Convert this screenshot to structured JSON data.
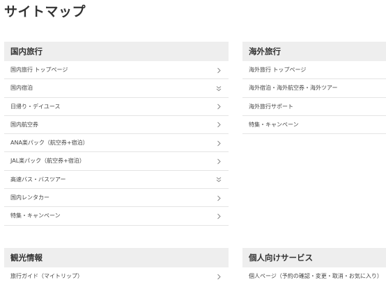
{
  "page": {
    "title": "サイトマップ"
  },
  "sections": {
    "domestic": {
      "title": "国内旅行",
      "items": [
        {
          "label": "国内旅行 トップページ",
          "icon": "chevron-right-icon"
        },
        {
          "label": "国内宿泊",
          "icon": "chevron-double-down-icon"
        },
        {
          "label": "日帰り・デイユース",
          "icon": "chevron-right-icon"
        },
        {
          "label": "国内航空券",
          "icon": "chevron-right-icon"
        },
        {
          "label": "ANA楽パック（航空券+宿泊）",
          "icon": "chevron-right-icon"
        },
        {
          "label": "JAL楽パック（航空券+宿泊）",
          "icon": "chevron-right-icon"
        },
        {
          "label": "高速バス・バスツアー",
          "icon": "chevron-double-down-icon"
        },
        {
          "label": "国内レンタカー",
          "icon": "chevron-right-icon"
        },
        {
          "label": "特集・キャンペーン",
          "icon": "chevron-right-icon"
        }
      ]
    },
    "overseas": {
      "title": "海外旅行",
      "items": [
        {
          "label": "海外旅行 トップページ"
        },
        {
          "label": "海外宿泊・海外航空券・海外ツアー"
        },
        {
          "label": "海外旅行サポート"
        },
        {
          "label": "特集・キャンペーン"
        }
      ]
    },
    "sightseeing": {
      "title": "観光情報",
      "items": [
        {
          "label": "旅行ガイド（マイトリップ）",
          "icon": "chevron-right-icon"
        }
      ]
    },
    "personal": {
      "title": "個人向けサービス",
      "items": [
        {
          "label": "個人ページ（予約の確認・変更・取消・お気に入り）"
        }
      ]
    }
  },
  "colors": {
    "header_bg": "#eeeeee",
    "divider": "#e4e4e4",
    "chevron": "#888888"
  }
}
